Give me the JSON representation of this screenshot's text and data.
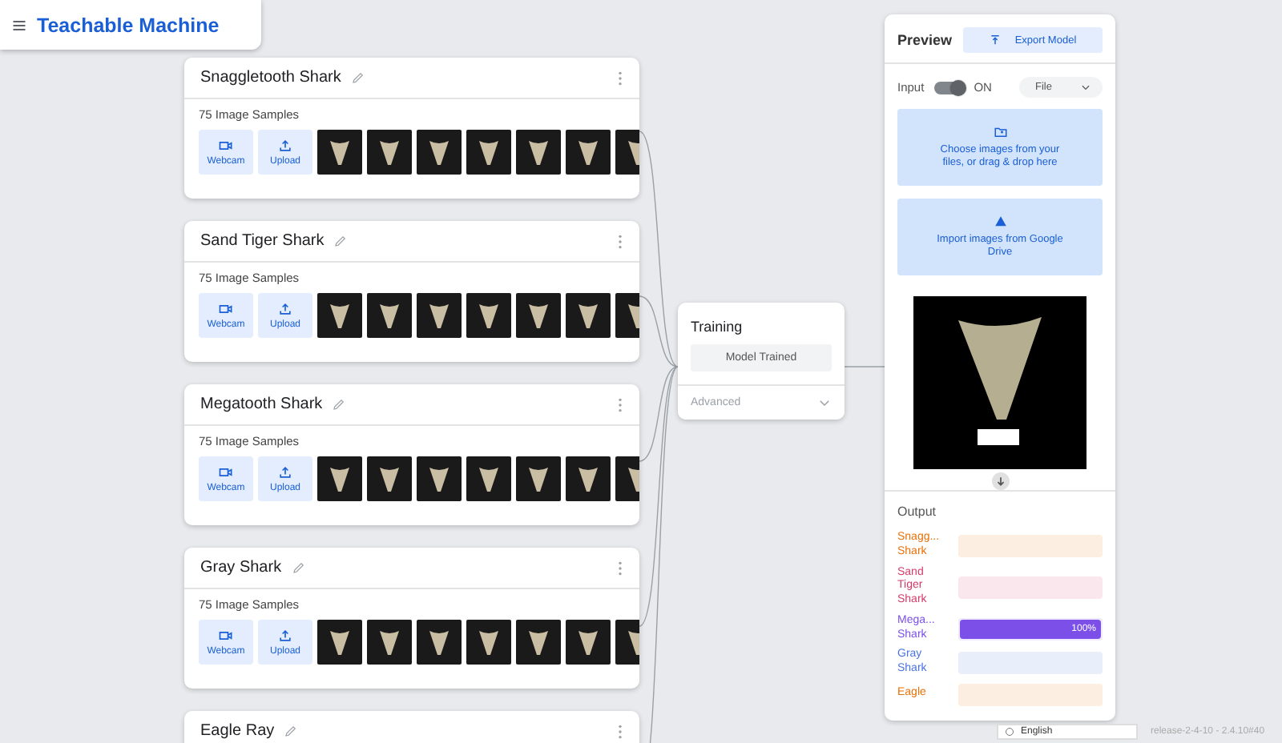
{
  "app": {
    "title": "Teachable Machine"
  },
  "classes": [
    {
      "name": "Snaggletooth Shark",
      "samples": "75 Image Samples",
      "webcam": "Webcam",
      "upload": "Upload"
    },
    {
      "name": "Sand Tiger Shark",
      "samples": "75 Image Samples",
      "webcam": "Webcam",
      "upload": "Upload"
    },
    {
      "name": "Megatooth Shark",
      "samples": "75 Image Samples",
      "webcam": "Webcam",
      "upload": "Upload"
    },
    {
      "name": "Gray Shark",
      "samples": "75 Image Samples",
      "webcam": "Webcam",
      "upload": "Upload"
    },
    {
      "name": "Eagle Ray"
    }
  ],
  "training": {
    "title": "Training",
    "button": "Model Trained",
    "advanced": "Advanced",
    "expanded": false
  },
  "preview": {
    "title": "Preview",
    "export": "Export Model",
    "input_label": "Input",
    "input_on": true,
    "input_state": "ON",
    "source": "File",
    "choose": "Choose images from your files, or drag & drop here",
    "drive": "Import images from Google Drive",
    "output_title": "Output",
    "outputs": [
      {
        "label": "Snagg... Shark",
        "color": "#e8710a",
        "level": 0
      },
      {
        "label": "Sand Tiger Shark",
        "color": "#d33b6a",
        "level": 0
      },
      {
        "label": "Mega... Shark",
        "color": "#7b4fe8",
        "level": 1,
        "reading": "100%"
      },
      {
        "label": "Gray Shark",
        "color": "#4a72e0",
        "level": 0
      },
      {
        "label": "Eagle",
        "color": "#e8710a",
        "level": 0
      }
    ]
  },
  "footer": {
    "language": "English",
    "version": "release-2-4-10 - 2.4.10#40"
  }
}
